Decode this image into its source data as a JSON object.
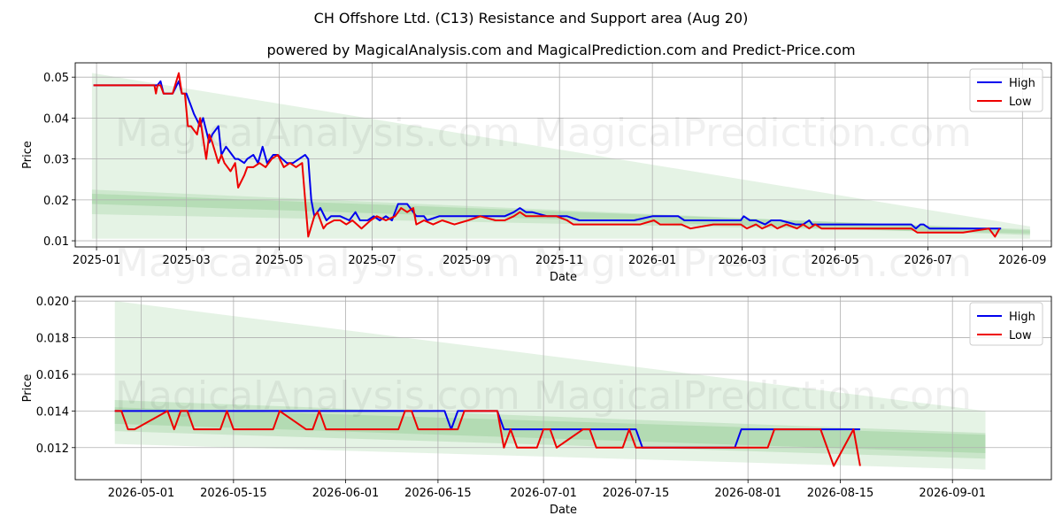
{
  "title": "CH Offshore Ltd. (C13) Resistance and Support area (Aug 20)",
  "subtitle": "powered by MagicalAnalysis.com and MagicalPrediction.com and Predict-Price.com",
  "watermarks": [
    "MagicalAnalysis.com",
    "MagicalPrediction.com"
  ],
  "colors": {
    "high": "#0000ee",
    "low": "#ee0000",
    "band": "#2ca02c",
    "grid": "#b0b0b0"
  },
  "chart_data": [
    {
      "type": "line",
      "xlabel": "Date",
      "ylabel": "Price",
      "legend": "top-right",
      "grid": true,
      "xlim": [
        "2024-12-18",
        "2026-09-20"
      ],
      "ylim": [
        0.0085,
        0.0535
      ],
      "xticks": [
        "2025-01",
        "2025-03",
        "2025-05",
        "2025-07",
        "2025-09",
        "2025-11",
        "2026-01",
        "2026-03",
        "2026-05",
        "2026-07",
        "2026-09"
      ],
      "xtick_dates": [
        "2025-01-01",
        "2025-03-01",
        "2025-05-01",
        "2025-07-01",
        "2025-09-01",
        "2025-11-01",
        "2026-01-01",
        "2026-03-01",
        "2026-05-01",
        "2026-07-01",
        "2026-09-01"
      ],
      "yticks": [
        "0.01",
        "0.02",
        "0.03",
        "0.04",
        "0.05"
      ],
      "ytick_values": [
        0.01,
        0.02,
        0.03,
        0.04,
        0.05
      ],
      "bands": [
        {
          "x": [
            "2024-12-29",
            "2026-09-06"
          ],
          "upper": [
            0.051,
            0.0135
          ],
          "lower": [
            0.0105,
            0.0105
          ],
          "opacity": 0.12
        },
        {
          "x": [
            "2024-12-29",
            "2026-09-06"
          ],
          "upper": [
            0.0225,
            0.0125
          ],
          "lower": [
            0.0165,
            0.0118
          ],
          "opacity": 0.12
        },
        {
          "x": [
            "2024-12-29",
            "2026-09-06"
          ],
          "upper": [
            0.0215,
            0.0128
          ],
          "lower": [
            0.019,
            0.0114
          ],
          "opacity": 0.15
        }
      ],
      "series": [
        {
          "name": "High",
          "x": [
            "2024-12-30",
            "2025-02-10",
            "2025-02-12",
            "2025-02-14",
            "2025-02-20",
            "2025-02-24",
            "2025-02-26",
            "2025-03-01",
            "2025-03-04",
            "2025-03-06",
            "2025-03-10",
            "2025-03-12",
            "2025-03-16",
            "2025-03-18",
            "2025-03-22",
            "2025-03-24",
            "2025-03-27",
            "2025-03-29",
            "2025-04-02",
            "2025-04-04",
            "2025-04-08",
            "2025-04-10",
            "2025-04-14",
            "2025-04-17",
            "2025-04-20",
            "2025-04-23",
            "2025-04-25",
            "2025-04-27",
            "2025-04-30",
            "2025-05-03",
            "2025-05-06",
            "2025-05-10",
            "2025-05-14",
            "2025-05-18",
            "2025-05-20",
            "2025-05-22",
            "2025-05-24",
            "2025-05-26",
            "2025-05-28",
            "2025-06-01",
            "2025-06-04",
            "2025-06-10",
            "2025-06-16",
            "2025-06-20",
            "2025-06-23",
            "2025-06-28",
            "2025-07-02",
            "2025-07-06",
            "2025-07-10",
            "2025-07-14",
            "2025-07-18",
            "2025-07-22",
            "2025-07-24",
            "2025-07-30",
            "2025-08-04",
            "2025-08-06",
            "2025-08-14",
            "2025-08-22",
            "2025-08-30",
            "2025-09-06",
            "2025-09-12",
            "2025-09-20",
            "2025-09-26",
            "2025-10-02",
            "2025-10-06",
            "2025-10-10",
            "2025-10-14",
            "2025-10-24",
            "2025-10-30",
            "2025-11-06",
            "2025-11-14",
            "2025-11-30",
            "2025-12-20",
            "2026-01-01",
            "2026-01-06",
            "2026-01-18",
            "2026-01-22",
            "2026-02-28",
            "2026-03-02",
            "2026-03-06",
            "2026-03-10",
            "2026-03-16",
            "2026-03-20",
            "2026-03-26",
            "2026-04-05",
            "2026-04-10",
            "2026-04-14",
            "2026-04-16",
            "2026-04-20",
            "2026-04-27",
            "2026-06-20",
            "2026-06-23",
            "2026-06-26",
            "2026-06-28",
            "2026-07-02",
            "2026-07-10",
            "2026-07-14",
            "2026-07-26",
            "2026-07-30",
            "2026-08-18"
          ],
          "y": [
            0.048,
            0.048,
            0.049,
            0.046,
            0.046,
            0.049,
            0.046,
            0.046,
            0.043,
            0.041,
            0.038,
            0.04,
            0.034,
            0.036,
            0.038,
            0.031,
            0.033,
            0.032,
            0.03,
            0.03,
            0.029,
            0.03,
            0.031,
            0.029,
            0.033,
            0.029,
            0.03,
            0.031,
            0.031,
            0.03,
            0.029,
            0.029,
            0.03,
            0.031,
            0.03,
            0.02,
            0.016,
            0.017,
            0.018,
            0.015,
            0.016,
            0.016,
            0.015,
            0.017,
            0.015,
            0.015,
            0.016,
            0.015,
            0.016,
            0.015,
            0.019,
            0.019,
            0.019,
            0.016,
            0.016,
            0.015,
            0.016,
            0.016,
            0.016,
            0.016,
            0.016,
            0.016,
            0.016,
            0.017,
            0.018,
            0.017,
            0.017,
            0.016,
            0.016,
            0.016,
            0.015,
            0.015,
            0.015,
            0.016,
            0.016,
            0.016,
            0.015,
            0.015,
            0.016,
            0.015,
            0.015,
            0.014,
            0.015,
            0.015,
            0.014,
            0.014,
            0.015,
            0.014,
            0.014,
            0.014,
            0.014,
            0.013,
            0.014,
            0.014,
            0.013,
            0.013,
            0.013,
            0.013,
            0.013,
            0.013
          ]
        },
        {
          "name": "Low",
          "x": [
            "2024-12-30",
            "2025-02-08",
            "2025-02-09",
            "2025-02-10",
            "2025-02-12",
            "2025-02-14",
            "2025-02-20",
            "2025-02-24",
            "2025-02-26",
            "2025-02-28",
            "2025-03-02",
            "2025-03-04",
            "2025-03-08",
            "2025-03-10",
            "2025-03-14",
            "2025-03-16",
            "2025-03-18",
            "2025-03-22",
            "2025-03-24",
            "2025-03-26",
            "2025-03-30",
            "2025-04-02",
            "2025-04-04",
            "2025-04-08",
            "2025-04-10",
            "2025-04-14",
            "2025-04-18",
            "2025-04-22",
            "2025-04-26",
            "2025-04-30",
            "2025-05-04",
            "2025-05-08",
            "2025-05-12",
            "2025-05-16",
            "2025-05-18",
            "2025-05-20",
            "2025-05-24",
            "2025-05-26",
            "2025-05-30",
            "2025-06-01",
            "2025-06-06",
            "2025-06-10",
            "2025-06-14",
            "2025-06-18",
            "2025-06-24",
            "2025-06-30",
            "2025-07-04",
            "2025-07-10",
            "2025-07-16",
            "2025-07-20",
            "2025-07-24",
            "2025-07-28",
            "2025-07-30",
            "2025-08-04",
            "2025-08-10",
            "2025-08-16",
            "2025-08-24",
            "2025-09-02",
            "2025-09-10",
            "2025-09-20",
            "2025-09-26",
            "2025-10-02",
            "2025-10-06",
            "2025-10-10",
            "2025-10-20",
            "2025-10-30",
            "2025-11-06",
            "2025-11-10",
            "2025-11-22",
            "2025-12-08",
            "2025-12-24",
            "2026-01-02",
            "2026-01-06",
            "2026-01-20",
            "2026-01-26",
            "2026-02-10",
            "2026-02-28",
            "2026-03-04",
            "2026-03-10",
            "2026-03-14",
            "2026-03-20",
            "2026-03-24",
            "2026-03-30",
            "2026-04-06",
            "2026-04-10",
            "2026-04-14",
            "2026-04-18",
            "2026-04-22",
            "2026-05-04",
            "2026-05-20",
            "2026-06-04",
            "2026-06-20",
            "2026-06-24",
            "2026-07-04",
            "2026-07-14",
            "2026-07-24",
            "2026-08-10",
            "2026-08-14",
            "2026-08-17"
          ],
          "y": [
            0.048,
            0.048,
            0.046,
            0.048,
            0.048,
            0.046,
            0.046,
            0.051,
            0.046,
            0.046,
            0.038,
            0.038,
            0.036,
            0.04,
            0.03,
            0.036,
            0.034,
            0.029,
            0.031,
            0.029,
            0.027,
            0.029,
            0.023,
            0.026,
            0.028,
            0.028,
            0.029,
            0.028,
            0.03,
            0.031,
            0.028,
            0.029,
            0.028,
            0.029,
            0.02,
            0.011,
            0.016,
            0.017,
            0.013,
            0.014,
            0.015,
            0.015,
            0.014,
            0.015,
            0.013,
            0.015,
            0.016,
            0.015,
            0.016,
            0.018,
            0.017,
            0.018,
            0.014,
            0.015,
            0.014,
            0.015,
            0.014,
            0.015,
            0.016,
            0.015,
            0.015,
            0.016,
            0.017,
            0.016,
            0.016,
            0.016,
            0.015,
            0.014,
            0.014,
            0.014,
            0.014,
            0.015,
            0.014,
            0.014,
            0.013,
            0.014,
            0.014,
            0.013,
            0.014,
            0.013,
            0.014,
            0.013,
            0.014,
            0.013,
            0.014,
            0.013,
            0.014,
            0.013,
            0.013,
            0.013,
            0.013,
            0.013,
            0.012,
            0.012,
            0.012,
            0.012,
            0.013,
            0.011,
            0.013
          ]
        }
      ]
    },
    {
      "type": "line",
      "xlabel": "Date",
      "ylabel": "Price",
      "legend": "top-right",
      "grid": true,
      "xlim": [
        "2026-04-21",
        "2026-09-16"
      ],
      "ylim": [
        0.01025,
        0.02025
      ],
      "xticks": [
        "2026-05-01",
        "2026-05-15",
        "2026-06-01",
        "2026-06-15",
        "2026-07-01",
        "2026-07-15",
        "2026-08-01",
        "2026-08-15",
        "2026-09-01"
      ],
      "xtick_dates": [
        "2026-05-01",
        "2026-05-15",
        "2026-06-01",
        "2026-06-15",
        "2026-07-01",
        "2026-07-15",
        "2026-08-01",
        "2026-08-15",
        "2026-09-01"
      ],
      "yticks": [
        "0.012",
        "0.014",
        "0.016",
        "0.018",
        "0.020"
      ],
      "ytick_values": [
        0.012,
        0.014,
        0.016,
        0.018,
        0.02
      ],
      "bands": [
        {
          "x": [
            "2026-04-27",
            "2026-09-06"
          ],
          "upper": [
            0.02,
            0.014
          ],
          "lower": [
            0.0122,
            0.0108
          ],
          "opacity": 0.12
        },
        {
          "x": [
            "2026-04-27",
            "2026-09-06"
          ],
          "upper": [
            0.0146,
            0.0128
          ],
          "lower": [
            0.0129,
            0.0114
          ],
          "opacity": 0.15
        },
        {
          "x": [
            "2026-04-27",
            "2026-09-06"
          ],
          "upper": [
            0.0142,
            0.0127
          ],
          "lower": [
            0.0133,
            0.0117
          ],
          "opacity": 0.15
        }
      ],
      "series": [
        {
          "name": "High",
          "x": [
            "2026-04-27",
            "2026-06-16",
            "2026-06-17",
            "2026-06-18",
            "2026-06-24",
            "2026-06-25",
            "2026-07-15",
            "2026-07-16",
            "2026-07-30",
            "2026-07-31",
            "2026-08-18"
          ],
          "y": [
            0.014,
            0.014,
            0.013,
            0.014,
            0.014,
            0.013,
            0.013,
            0.012,
            0.012,
            0.013,
            0.013
          ]
        },
        {
          "name": "Low",
          "x": [
            "2026-04-27",
            "2026-04-28",
            "2026-04-29",
            "2026-04-30",
            "2026-05-05",
            "2026-05-06",
            "2026-05-07",
            "2026-05-08",
            "2026-05-09",
            "2026-05-13",
            "2026-05-14",
            "2026-05-15",
            "2026-05-21",
            "2026-05-22",
            "2026-05-26",
            "2026-05-27",
            "2026-05-28",
            "2026-05-29",
            "2026-06-09",
            "2026-06-10",
            "2026-06-11",
            "2026-06-12",
            "2026-06-18",
            "2026-06-19",
            "2026-06-24",
            "2026-06-25",
            "2026-06-26",
            "2026-06-27",
            "2026-06-30",
            "2026-07-01",
            "2026-07-02",
            "2026-07-03",
            "2026-07-07",
            "2026-07-08",
            "2026-07-09",
            "2026-07-13",
            "2026-07-14",
            "2026-07-15",
            "2026-07-31",
            "2026-08-04",
            "2026-08-05",
            "2026-08-12",
            "2026-08-14",
            "2026-08-17",
            "2026-08-18"
          ],
          "y": [
            0.014,
            0.014,
            0.013,
            0.013,
            0.014,
            0.013,
            0.014,
            0.014,
            0.013,
            0.013,
            0.014,
            0.013,
            0.013,
            0.014,
            0.013,
            0.013,
            0.014,
            0.013,
            0.013,
            0.014,
            0.014,
            0.013,
            0.013,
            0.014,
            0.014,
            0.012,
            0.013,
            0.012,
            0.012,
            0.013,
            0.013,
            0.012,
            0.013,
            0.013,
            0.012,
            0.012,
            0.013,
            0.012,
            0.012,
            0.012,
            0.013,
            0.013,
            0.011,
            0.013,
            0.011
          ]
        }
      ]
    }
  ]
}
